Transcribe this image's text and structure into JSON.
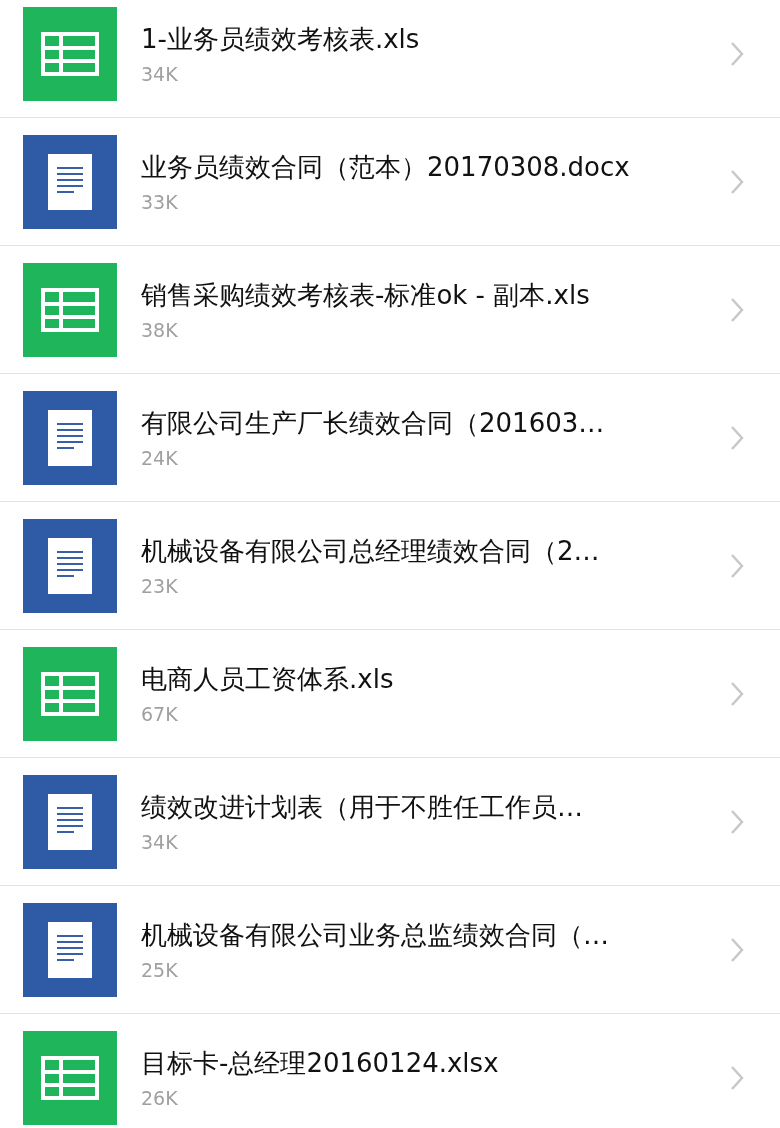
{
  "files": [
    {
      "kind": "sheet",
      "name": "1-业务员绩效考核表.xls",
      "size": "34K"
    },
    {
      "kind": "doc",
      "name": "业务员绩效合同（范本）20170308.docx",
      "size": "33K"
    },
    {
      "kind": "sheet",
      "name": "销售采购绩效考核表-标准ok - 副本.xls",
      "size": "38K"
    },
    {
      "kind": "doc",
      "name": "有限公司生产厂长绩效合同（201603…",
      "size": "24K"
    },
    {
      "kind": "doc",
      "name": "机械设备有限公司总经理绩效合同（2…",
      "size": "23K"
    },
    {
      "kind": "sheet",
      "name": "电商人员工资体系.xls",
      "size": "67K"
    },
    {
      "kind": "doc",
      "name": "绩效改进计划表（用于不胜任工作员…",
      "size": "34K"
    },
    {
      "kind": "doc",
      "name": "机械设备有限公司业务总监绩效合同（…",
      "size": "25K"
    },
    {
      "kind": "sheet",
      "name": "目标卡-总经理20160124.xlsx",
      "size": "26K"
    }
  ]
}
